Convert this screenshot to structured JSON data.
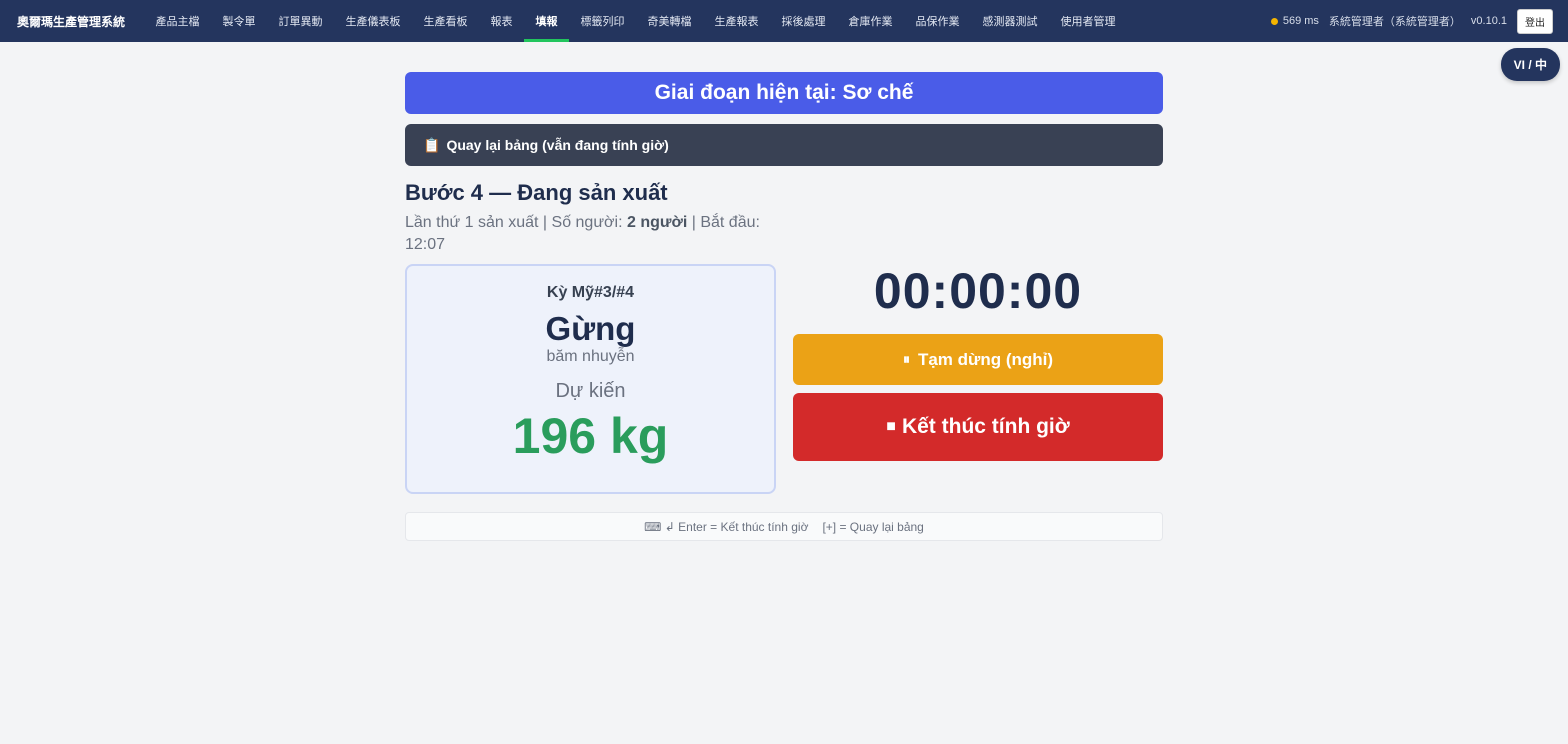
{
  "app": {
    "title": "奧爾瑪生產管理系統"
  },
  "nav": {
    "items": [
      {
        "label": "產品主檔"
      },
      {
        "label": "製令單"
      },
      {
        "label": "訂單異動"
      },
      {
        "label": "生產儀表板"
      },
      {
        "label": "生產看板"
      },
      {
        "label": "報表"
      },
      {
        "label": "填報"
      },
      {
        "label": "標籤列印"
      },
      {
        "label": "奇美轉檔"
      },
      {
        "label": "生產報表"
      },
      {
        "label": "採後處理"
      },
      {
        "label": "倉庫作業"
      },
      {
        "label": "品保作業"
      },
      {
        "label": "感測器測試"
      },
      {
        "label": "使用者管理"
      }
    ],
    "active_index": 6,
    "latency": "569 ms",
    "user": "系統管理者（系統管理者）",
    "version": "v0.10.1",
    "logout_label": "登出",
    "status_color": "#f4b400"
  },
  "lang_toggle": "VI / 中",
  "stage": {
    "banner": "Giai đoạn hiện tại: Sơ chế",
    "back_label": "Quay lại bảng (vẫn đang tính giờ)",
    "back_icon": "clipboard-icon"
  },
  "step": {
    "title": "Bước 4 — Đang sản xuất",
    "meta_prefix": "Lần thứ 1 sản xuất  |  Số người: ",
    "people": "2 người",
    "meta_suffix": "  |  Bắt đầu: 12:07"
  },
  "product": {
    "code": "Kỳ Mỹ#3/#4",
    "name": "Gừng",
    "sub": "băm nhuyễn",
    "expected_label": "Dự kiến",
    "expected_qty": "196 kg"
  },
  "timer": {
    "value": "00:00:00",
    "pause_icon": "⏸",
    "pause_label": "Tạm dừng (nghỉ)",
    "stop_icon": "■",
    "stop_label": "Kết thúc tính giờ"
  },
  "hints": {
    "left": "⌨ ↲ Enter = Kết thúc tính giờ",
    "right": "[+] = Quay lại bảng"
  },
  "colors": {
    "nav_bg": "#24355e",
    "banner": "#4a5ce8",
    "back": "#394154",
    "pause": "#eba216",
    "stop": "#d32a2a",
    "qty": "#2a9d5c"
  }
}
